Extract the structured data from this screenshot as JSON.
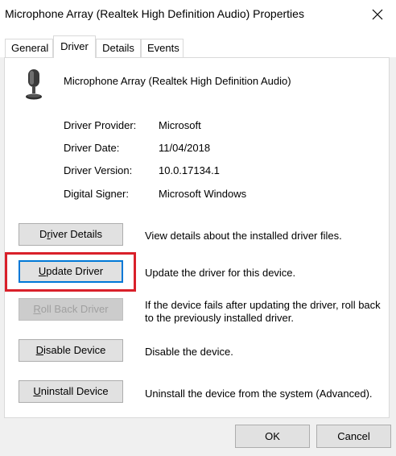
{
  "window": {
    "title": "Microphone Array (Realtek High Definition Audio) Properties"
  },
  "tabs": [
    {
      "label": "General",
      "active": false
    },
    {
      "label": "Driver",
      "active": true
    },
    {
      "label": "Details",
      "active": false
    },
    {
      "label": "Events",
      "active": false
    }
  ],
  "device": {
    "name": "Microphone Array (Realtek High Definition Audio)",
    "icon": "microphone-icon"
  },
  "info": [
    {
      "label": "Driver Provider:",
      "value": "Microsoft"
    },
    {
      "label": "Driver Date:",
      "value": "11/04/2018"
    },
    {
      "label": "Driver Version:",
      "value": "10.0.17134.1"
    },
    {
      "label": "Digital Signer:",
      "value": "Microsoft Windows"
    }
  ],
  "actions": [
    {
      "label_pre": "D",
      "label_key": "r",
      "label_post": "iver Details",
      "description": "View details about the installed driver files.",
      "enabled": true
    },
    {
      "label_pre": "",
      "label_key": "U",
      "label_post": "pdate Driver",
      "description": "Update the driver for this device.",
      "enabled": true
    },
    {
      "label_pre": "",
      "label_key": "R",
      "label_post": "oll Back Driver",
      "description": "If the device fails after updating the driver, roll back to the previously installed driver.",
      "enabled": false
    },
    {
      "label_pre": "",
      "label_key": "D",
      "label_post": "isable Device",
      "description": "Disable the device.",
      "enabled": true
    },
    {
      "label_pre": "",
      "label_key": "U",
      "label_post": "ninstall Device",
      "description": "Uninstall the device from the system (Advanced).",
      "enabled": true
    }
  ],
  "footer": {
    "ok_label": "OK",
    "cancel_label": "Cancel"
  },
  "colors": {
    "highlight": "#d9202a",
    "focus": "#0078d7"
  }
}
